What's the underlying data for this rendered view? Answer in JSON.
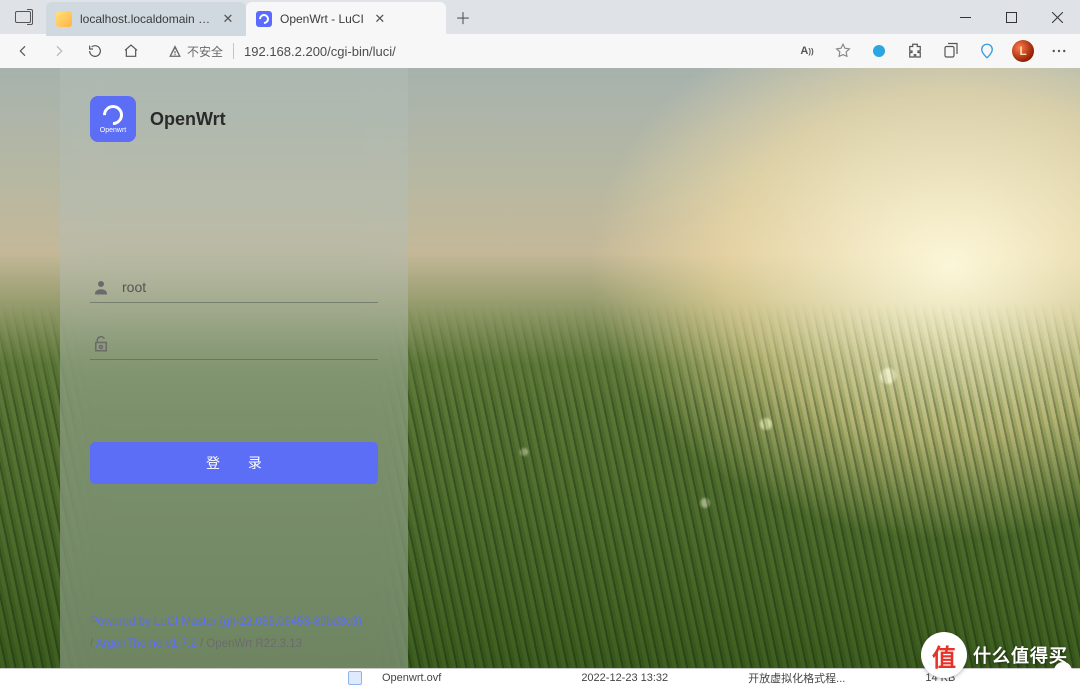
{
  "browser": {
    "tabs": [
      {
        "title": "localhost.localdomain - VMware",
        "active": false
      },
      {
        "title": "OpenWrt - LuCI",
        "active": true
      }
    ],
    "address": {
      "insecure_label": "不安全",
      "url": "192.168.2.200/cgi-bin/luci/"
    },
    "profile_initial": "L"
  },
  "page": {
    "brand": {
      "logo_sub": "Openwrt",
      "title": "OpenWrt"
    },
    "username": {
      "value": "root",
      "placeholder": ""
    },
    "password": {
      "value": "",
      "placeholder": ""
    },
    "login_label": "登 录",
    "footer": {
      "line1": "Powered by LuCI Master (git-22.085.06453-89bd3c3)",
      "sep": " / ",
      "theme": "ArgonTheme v1.7.2",
      "tail": " / OpenWrt R22.3.13"
    }
  },
  "behind_bar": {
    "file": "Openwrt.ovf",
    "date": "2022-12-23 13:32",
    "type": "开放虚拟化格式程...",
    "size": "14 KB"
  },
  "watermark": {
    "symbol": "值",
    "text": "什么值得买"
  }
}
